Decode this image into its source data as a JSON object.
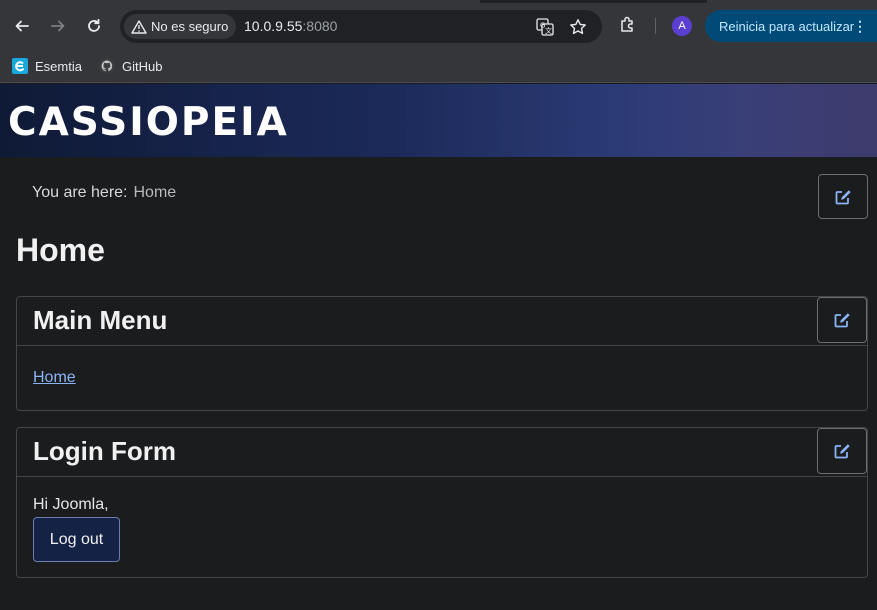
{
  "browser": {
    "security_label": "No es seguro",
    "url_host": "10.0.9.55",
    "url_port": ":8080",
    "avatar_letter": "A",
    "update_label": "Reinicia para actualizar",
    "bookmarks": [
      {
        "label": "Esemtia",
        "icon": "esemtia-icon"
      },
      {
        "label": "GitHub",
        "icon": "github-icon"
      }
    ]
  },
  "site": {
    "brand": "CASSIOPEIA"
  },
  "breadcrumb": {
    "prefix": "You are here:",
    "current": "Home"
  },
  "page": {
    "title": "Home"
  },
  "modules": {
    "main_menu": {
      "title": "Main Menu",
      "items": [
        {
          "label": "Home"
        }
      ]
    },
    "login": {
      "title": "Login Form",
      "greeting": "Hi Joomla,",
      "logout_label": "Log out"
    }
  },
  "colors": {
    "header_start": "#0f1a36",
    "header_end": "#3e3b6d",
    "link": "#8ab4f8",
    "logout_bg": "#132245",
    "edit_icon": "#8ab4f8"
  }
}
